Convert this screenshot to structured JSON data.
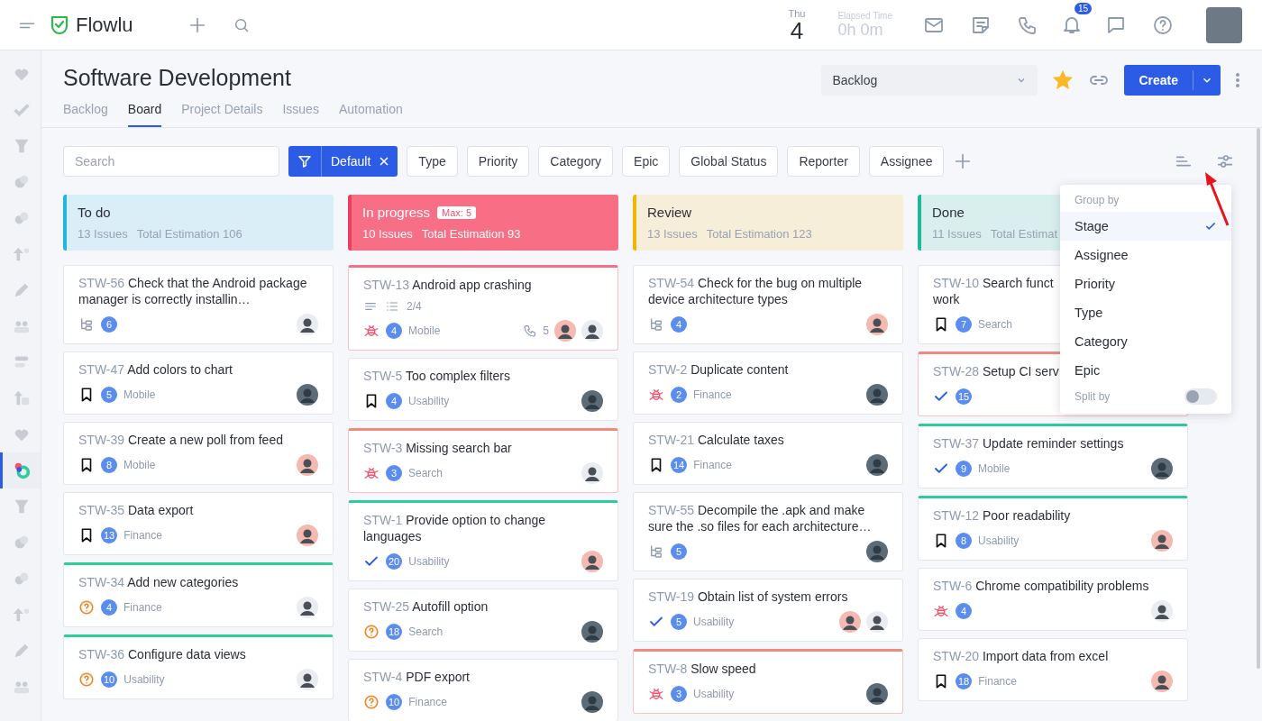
{
  "topbar": {
    "logo": "Flowlu",
    "day_name": "Thu",
    "day": "4",
    "elapsed_label": "Elapsed Time",
    "elapsed": "0h 0m",
    "notifications": "15"
  },
  "sidebar": {
    "items": [
      {
        "selected": false
      },
      {
        "selected": false
      },
      {
        "selected": false
      },
      {
        "selected": false
      },
      {
        "selected": false
      },
      {
        "selected": false
      },
      {
        "selected": false
      },
      {
        "selected": false
      },
      {
        "selected": false
      },
      {
        "selected": false
      },
      {
        "selected": false
      },
      {
        "selected": true
      },
      {
        "selected": false
      },
      {
        "selected": false
      },
      {
        "selected": false
      },
      {
        "selected": false
      },
      {
        "selected": false
      },
      {
        "selected": false
      }
    ]
  },
  "header": {
    "title": "Software Development",
    "view_select": "Backlog",
    "favorite": true,
    "create": "Create",
    "tabs": [
      {
        "label": "Backlog",
        "selected": false
      },
      {
        "label": "Board",
        "selected": true
      },
      {
        "label": "Project Details",
        "selected": false
      },
      {
        "label": "Issues",
        "selected": false
      },
      {
        "label": "Automation",
        "selected": false
      }
    ]
  },
  "filters": {
    "placeholder": "Search",
    "active_filter": "Default",
    "chips": [
      "Type",
      "Priority",
      "Category",
      "Epic",
      "Global Status",
      "Reporter",
      "Assignee"
    ]
  },
  "columns": [
    {
      "name": "To do",
      "color": "#1fb6e0",
      "highlighted": false,
      "issues": "13 Issues",
      "estimation": "Total Estimation 106",
      "cards": [
        {
          "id": "STW-56",
          "title": "Check that the Android package manager is correctly installin…",
          "kind": "subtasks",
          "count": "6",
          "avatars": [
            {
              "kind": "man"
            }
          ]
        },
        {
          "id": "STW-47",
          "title": "Add colors to chart",
          "kind": "story",
          "count": "5",
          "tag": "Mobile",
          "avatars": [
            {
              "kind": "dark"
            }
          ]
        },
        {
          "id": "STW-39",
          "title": "Create a new poll from feed",
          "kind": "story",
          "count": "8",
          "tag": "Mobile",
          "avatars": [
            {
              "kind": "woman"
            }
          ]
        },
        {
          "id": "STW-35",
          "title": "Data export",
          "kind": "story",
          "count": "13",
          "tag": "Finance",
          "avatars": [
            {
              "kind": "woman"
            }
          ]
        },
        {
          "id": "STW-34",
          "title": "Add new categories",
          "kind": "question",
          "count": "4",
          "tag": "Finance",
          "color": "#2ecc9a",
          "avatars": [
            {
              "kind": "man"
            }
          ]
        },
        {
          "id": "STW-36",
          "title": "Configure data views",
          "kind": "question",
          "count": "10",
          "tag": "Usability",
          "color": "#2ecc9a",
          "avatars": [
            {
              "kind": "man"
            }
          ]
        }
      ]
    },
    {
      "name": "In progress",
      "color": "#f76e85",
      "highlighted": true,
      "limit": "Max: 5",
      "issues": "10 Issues",
      "estimation": "Total Estimation 93",
      "cards": [
        {
          "id": "STW-13",
          "title": "Android app crashing",
          "kind": "bug",
          "count": "4",
          "tag": "Mobile",
          "color": "#f76e85",
          "checklist": "2/4",
          "calls": "5",
          "avatars": [
            {
              "kind": "woman"
            },
            {
              "kind": "man"
            }
          ]
        },
        {
          "id": "STW-5",
          "title": "Too complex filters",
          "kind": "story",
          "count": "4",
          "tag": "Usability",
          "avatars": [
            {
              "kind": "dark"
            }
          ]
        },
        {
          "id": "STW-3",
          "title": "Missing search bar",
          "kind": "bug",
          "count": "3",
          "tag": "Search",
          "color": "#f08a7e",
          "avatars": [
            {
              "kind": "man"
            }
          ]
        },
        {
          "id": "STW-1",
          "title": "Provide option to change languages",
          "kind": "done",
          "count": "20",
          "tag": "Usability",
          "color": "#2ecc9a",
          "avatars": [
            {
              "kind": "woman"
            }
          ]
        },
        {
          "id": "STW-25",
          "title": "Autofill option",
          "kind": "question",
          "count": "18",
          "tag": "Search",
          "avatars": [
            {
              "kind": "dark"
            }
          ]
        },
        {
          "id": "STW-4",
          "title": "PDF export",
          "kind": "question",
          "count": "10",
          "tag": "Finance",
          "avatars": [
            {
              "kind": "dark"
            }
          ]
        }
      ]
    },
    {
      "name": "Review",
      "color": "#f5b400",
      "highlighted": false,
      "issues": "13 Issues",
      "estimation": "Total Estimation 123",
      "cards": [
        {
          "id": "STW-54",
          "title": "Check for the bug on multiple device architecture types",
          "kind": "subtasks",
          "count": "4",
          "avatars": [
            {
              "kind": "woman"
            }
          ]
        },
        {
          "id": "STW-2",
          "title": "Duplicate content",
          "kind": "bug",
          "count": "2",
          "tag": "Finance",
          "avatars": [
            {
              "kind": "dark"
            }
          ]
        },
        {
          "id": "STW-21",
          "title": "Calculate taxes",
          "kind": "story",
          "count": "14",
          "tag": "Finance",
          "avatars": [
            {
              "kind": "dark"
            }
          ]
        },
        {
          "id": "STW-55",
          "title": "Decompile the .apk and make sure the .so files for each architecture…",
          "kind": "subtasks",
          "count": "5",
          "avatars": [
            {
              "kind": "dark"
            }
          ]
        },
        {
          "id": "STW-19",
          "title": "Obtain list of system errors",
          "kind": "done",
          "count": "5",
          "tag": "Usability",
          "avatars": [
            {
              "kind": "woman"
            },
            {
              "kind": "man"
            }
          ]
        },
        {
          "id": "STW-8",
          "title": "Slow speed",
          "kind": "bug",
          "count": "3",
          "tag": "Usability",
          "color": "#f08a7e",
          "avatars": [
            {
              "kind": "dark"
            }
          ]
        }
      ]
    },
    {
      "name": "Done",
      "color": "#1fb89a",
      "highlighted": false,
      "issues": "11 Issues",
      "estimation": "Total Estimat",
      "cards": [
        {
          "id": "STW-10",
          "title": "Search funct",
          "title_2": "work",
          "kind": "story",
          "count": "7",
          "tag": "Search"
        },
        {
          "id": "STW-28",
          "title": "Setup CI serv",
          "kind": "done",
          "count": "15",
          "color": "#f08a7e"
        },
        {
          "id": "STW-37",
          "title": "Update reminder settings",
          "kind": "done",
          "count": "9",
          "tag": "Mobile",
          "color": "#2ecc9a",
          "avatars": [
            {
              "kind": "dark"
            }
          ]
        },
        {
          "id": "STW-12",
          "title": "Poor readability",
          "kind": "story",
          "count": "8",
          "tag": "Usability",
          "color": "#2ecc9a",
          "avatars": [
            {
              "kind": "woman"
            }
          ]
        },
        {
          "id": "STW-6",
          "title": "Chrome compatibility problems",
          "kind": "bug",
          "count": "4",
          "avatars": [
            {
              "kind": "man"
            }
          ]
        },
        {
          "id": "STW-20",
          "title": "Import data from excel",
          "kind": "story",
          "count": "18",
          "tag": "Finance",
          "avatars": [
            {
              "kind": "woman"
            }
          ]
        }
      ]
    }
  ],
  "group_menu": {
    "title": "Group by",
    "options": [
      {
        "label": "Stage",
        "selected": true
      },
      {
        "label": "Assignee",
        "selected": false
      },
      {
        "label": "Priority",
        "selected": false
      },
      {
        "label": "Type",
        "selected": false
      },
      {
        "label": "Category",
        "selected": false
      },
      {
        "label": "Epic",
        "selected": false
      }
    ],
    "split_label": "Split by",
    "split_on": false
  }
}
